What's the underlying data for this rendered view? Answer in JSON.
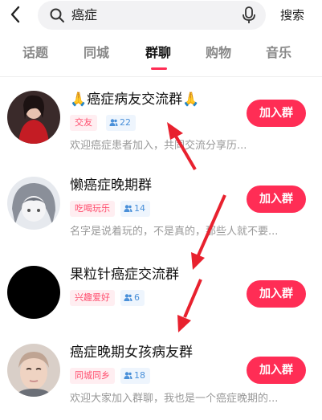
{
  "search": {
    "query": "癌症",
    "button_label": "搜索"
  },
  "tabs": [
    {
      "label": "话题"
    },
    {
      "label": "同城"
    },
    {
      "label": "群聊"
    },
    {
      "label": "购物"
    },
    {
      "label": "音乐"
    }
  ],
  "active_tab": "群聊",
  "groups": [
    {
      "name": "🙏癌症病友交流群🙏",
      "tag": "交友",
      "members": "22",
      "desc": "欢迎癌症患者加入，共同交流分享历...",
      "join_label": "加入群"
    },
    {
      "name": "懒癌症晚期群",
      "tag": "吃喝玩乐",
      "members": "14",
      "desc": "名字是说着玩的，不是真的，那些人就不要...",
      "join_label": "加入群"
    },
    {
      "name": "果粒针癌症交流群",
      "tag": "兴趣爱好",
      "members": "6",
      "desc": "",
      "join_label": "加入群"
    },
    {
      "name": "癌症晚期女孩病友群",
      "tag": "同城同乡",
      "members": "18",
      "desc": "欢迎大家加入群聊，我也是一个癌症晚期的...",
      "join_label": "加入群"
    }
  ],
  "colors": {
    "accent": "#ff2d55",
    "arrow": "#e8212e"
  }
}
